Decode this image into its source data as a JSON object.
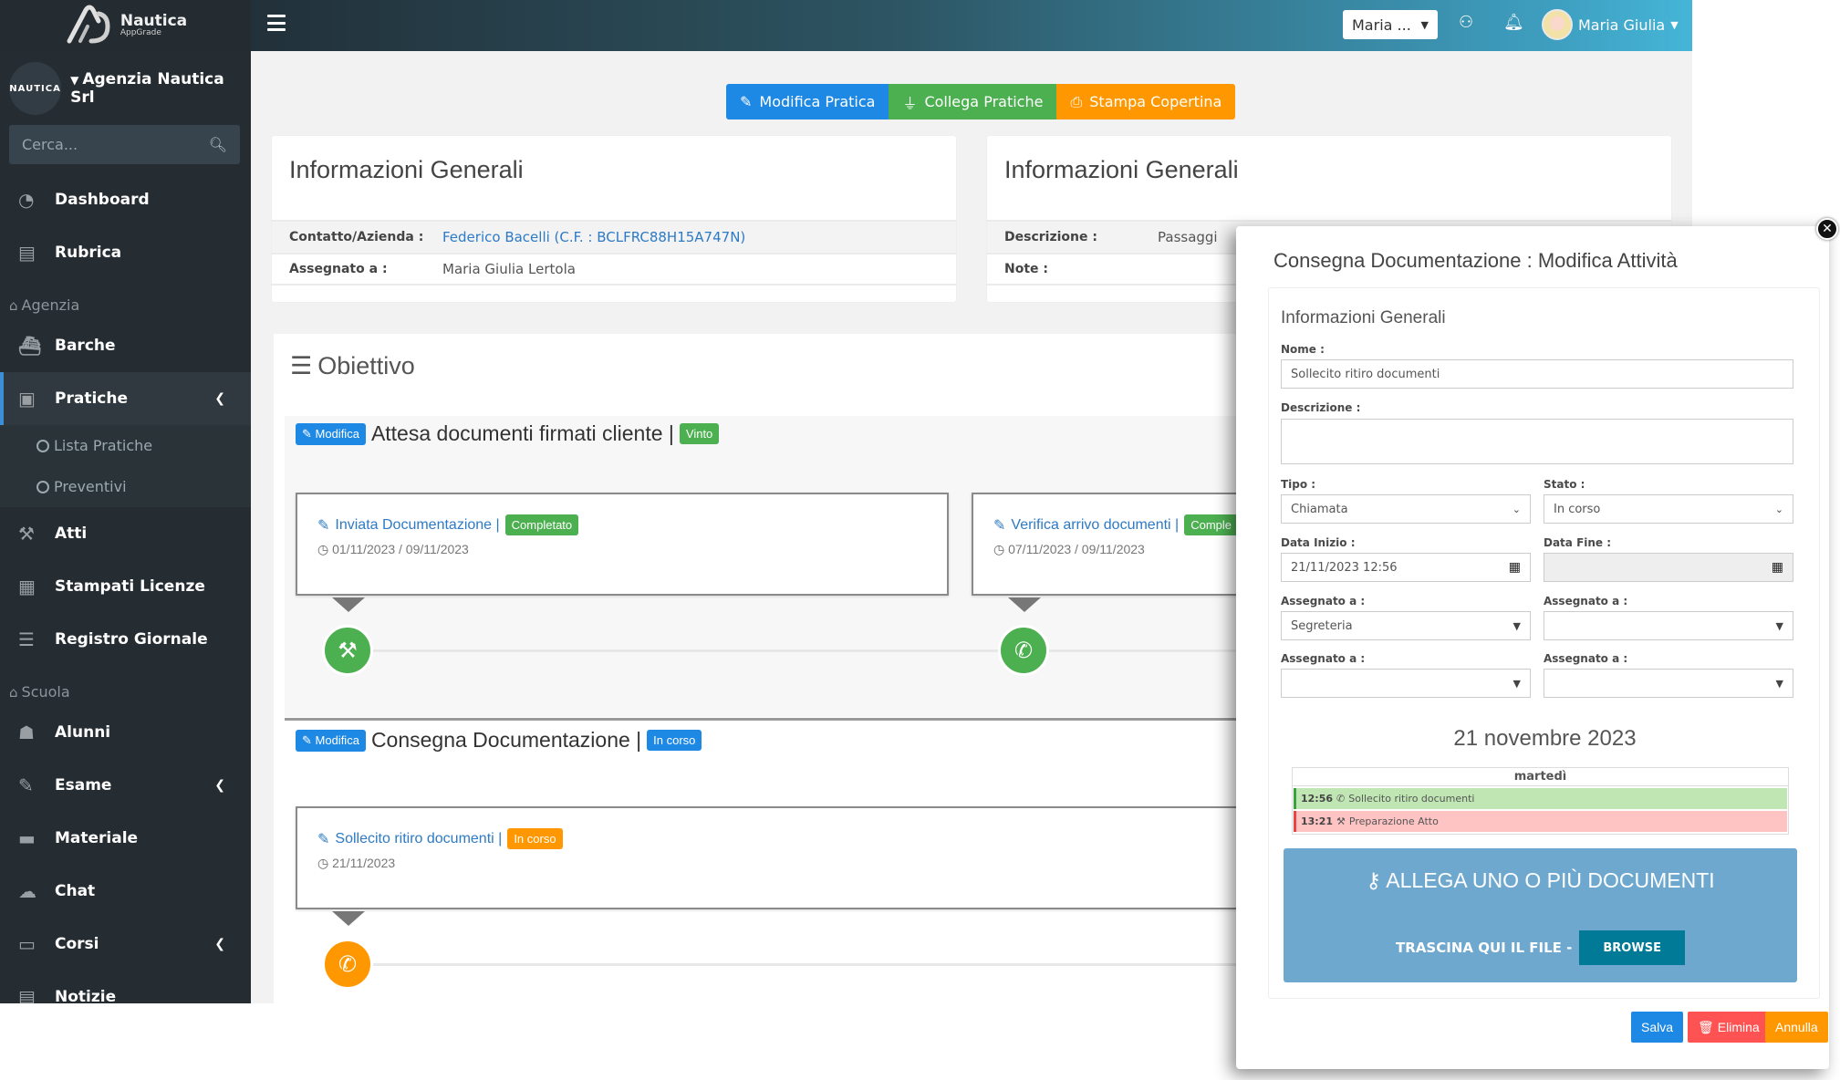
{
  "brand": {
    "name": "Nautica",
    "sub": "AppGrade"
  },
  "agency": {
    "logo_text": "NAUTICA",
    "name": "Agenzia Nautica Srl"
  },
  "search": {
    "placeholder": "Cerca..."
  },
  "sidebar": {
    "items": [
      {
        "label": "Dashboard",
        "icon": "dashboard-icon"
      },
      {
        "label": "Rubrica",
        "icon": "book-icon"
      }
    ],
    "section_agenzia": "Agenzia",
    "agenzia_items": [
      {
        "label": "Barche",
        "icon": "ship-icon"
      },
      {
        "label": "Pratiche",
        "icon": "file-icon",
        "active": true,
        "expanded": true
      }
    ],
    "pratiche_sub": [
      {
        "label": "Lista Pratiche"
      },
      {
        "label": "Preventivi"
      }
    ],
    "agenzia_items2": [
      {
        "label": "Atti",
        "icon": "gavel-icon"
      },
      {
        "label": "Stampati Licenze",
        "icon": "document-icon"
      },
      {
        "label": "Registro Giornale",
        "icon": "list-icon"
      }
    ],
    "section_scuola": "Scuola",
    "scuola_items": [
      {
        "label": "Alunni",
        "icon": "graduate-icon"
      },
      {
        "label": "Esame",
        "icon": "exam-icon"
      },
      {
        "label": "Materiale",
        "icon": "folder-icon"
      },
      {
        "label": "Chat",
        "icon": "chat-icon"
      },
      {
        "label": "Corsi",
        "icon": "teacher-icon"
      },
      {
        "label": "Notizie",
        "icon": "newspaper-icon"
      }
    ]
  },
  "header": {
    "select_value": "Maria ...",
    "user_name": "Maria Giulia"
  },
  "toolbar": {
    "modifica": "Modifica Pratica",
    "collega": "Collega Pratiche",
    "stampa": "Stampa Copertina"
  },
  "info_left": {
    "title": "Informazioni Generali",
    "rows": [
      {
        "label": "Contatto/Azienda :",
        "value": "Federico Bacelli (C.F. : BCLFRC88H15A747N)"
      },
      {
        "label": "Assegnato a :",
        "value": "Maria Giulia Lertola"
      }
    ]
  },
  "info_right": {
    "title": "Informazioni Generali",
    "rows": [
      {
        "label": "Descrizione :",
        "value": "Passaggi"
      },
      {
        "label": "Note :",
        "value": ""
      }
    ]
  },
  "objective": {
    "title": "Obiettivo",
    "modify_label": "Modifica",
    "phases": [
      {
        "name": "Attesa documenti firmati cliente |",
        "status": "Vinto",
        "tasks": [
          {
            "name": "Inviata Documentazione |",
            "status": "Completato",
            "dates": "01/11/2023 / 09/11/2023",
            "type": "gavel"
          },
          {
            "name": "Verifica arrivo documenti |",
            "status": "Comple",
            "dates": "07/11/2023 / 09/11/2023",
            "type": "phone"
          }
        ]
      },
      {
        "name": "Consegna Documentazione |",
        "status": "In corso",
        "tasks": [
          {
            "name": "Sollecito ritiro documenti |",
            "status": "In corso",
            "dates": "21/11/2023",
            "type": "phone"
          }
        ]
      }
    ]
  },
  "modal": {
    "title": "Consegna Documentazione : Modifica Attività",
    "section_title": "Informazioni Generali",
    "nome_label": "Nome :",
    "nome_value": "Sollecito ritiro documenti",
    "descrizione_label": "Descrizione :",
    "descrizione_value": "",
    "tipo_label": "Tipo :",
    "tipo_value": "Chiamata",
    "stato_label": "Stato :",
    "stato_value": "In corso",
    "data_inizio_label": "Data Inizio :",
    "data_inizio_value": "21/11/2023 12:56",
    "data_fine_label": "Data Fine :",
    "data_fine_value": "",
    "assegnato_label": "Assegnato a :",
    "assegnato_values": [
      "Segreteria",
      "",
      "",
      ""
    ],
    "calendar": {
      "date": "21 novembre 2023",
      "day": "martedì",
      "events": [
        {
          "time": "12:56",
          "icon": "phone-icon",
          "title": "Sollecito ritiro documenti",
          "color": "#c0e6b4"
        },
        {
          "time": "13:21",
          "icon": "gavel-icon",
          "title": "Preparazione Atto",
          "color": "#fec4c4"
        }
      ]
    },
    "dropzone": {
      "title": "ALLEGA UNO O PIÙ DOCUMENTI",
      "hint": "TRASCINA QUI IL FILE -",
      "browse": "BROWSE"
    },
    "buttons": {
      "salva": "Salva",
      "elimina": "Elimina",
      "annulla": "Annulla"
    }
  },
  "colors": {
    "primary": "#1e88e5",
    "success": "#4caf50",
    "warning": "#ff9800",
    "danger": "#ff5252",
    "sidebar": "#252d33"
  }
}
